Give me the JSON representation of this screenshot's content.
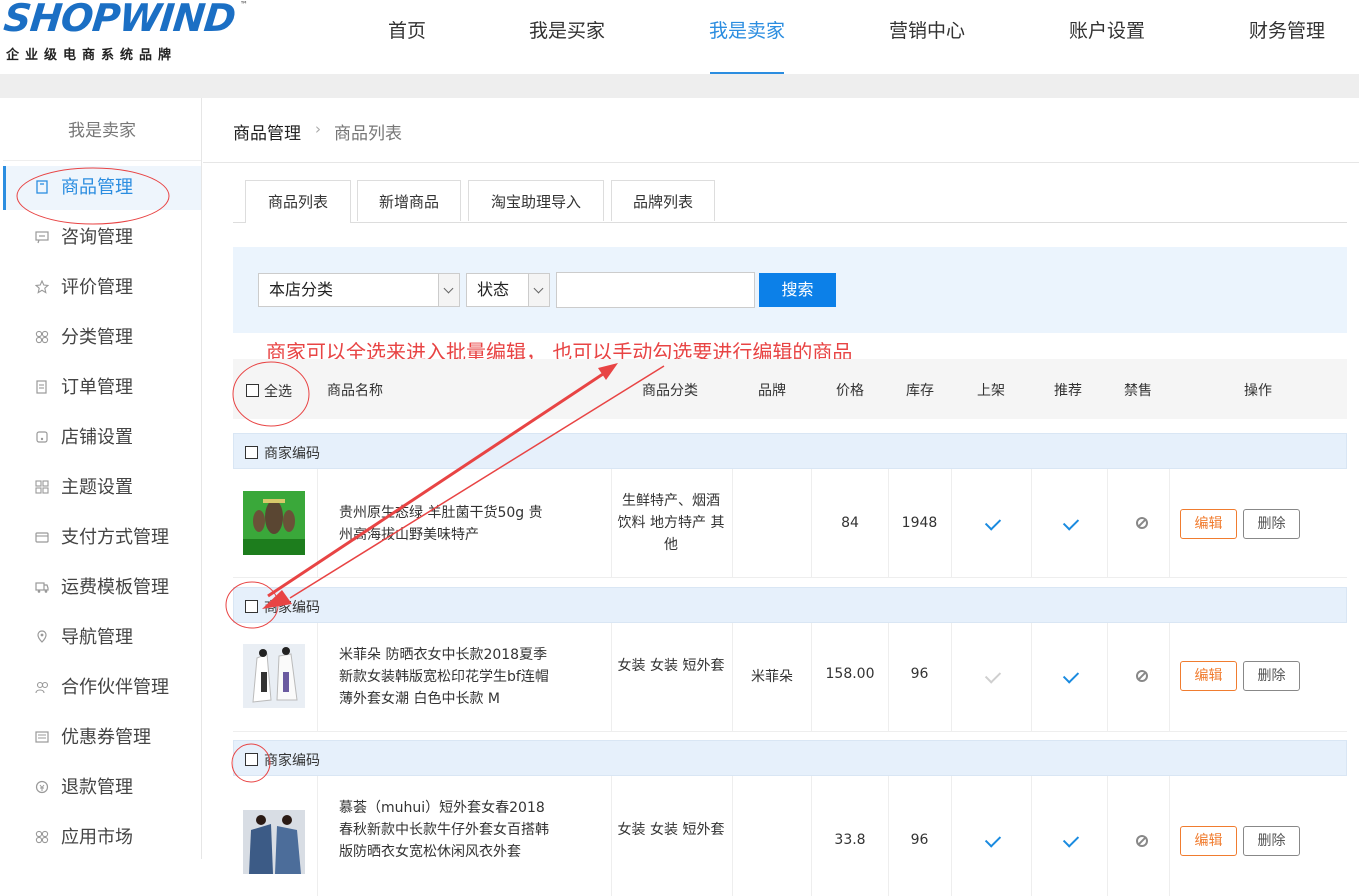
{
  "logo": {
    "main": "SHOPWIND",
    "tm": "™",
    "sub": "企业级电商系统品牌"
  },
  "nav": [
    "首页",
    "我是买家",
    "我是卖家",
    "营销中心",
    "账户设置",
    "财务管理"
  ],
  "nav_active": "我是卖家",
  "sidebar": {
    "title": "我是卖家",
    "items": [
      {
        "label": "商品管理",
        "icon": "goods-icon"
      },
      {
        "label": "咨询管理",
        "icon": "chat-icon"
      },
      {
        "label": "评价管理",
        "icon": "star-icon"
      },
      {
        "label": "分类管理",
        "icon": "category-icon"
      },
      {
        "label": "订单管理",
        "icon": "order-icon"
      },
      {
        "label": "店铺设置",
        "icon": "store-icon"
      },
      {
        "label": "主题设置",
        "icon": "theme-icon"
      },
      {
        "label": "支付方式管理",
        "icon": "wallet-icon"
      },
      {
        "label": "运费模板管理",
        "icon": "truck-icon"
      },
      {
        "label": "导航管理",
        "icon": "location-icon"
      },
      {
        "label": "合作伙伴管理",
        "icon": "partner-icon"
      },
      {
        "label": "优惠券管理",
        "icon": "coupon-icon"
      },
      {
        "label": "退款管理",
        "icon": "refund-icon"
      },
      {
        "label": "应用市场",
        "icon": "apps-icon"
      }
    ]
  },
  "breadcrumb": {
    "level1": "商品管理",
    "separator": "›",
    "level2": "商品列表"
  },
  "tabs": [
    "商品列表",
    "新增商品",
    "淘宝助理导入",
    "品牌列表"
  ],
  "search": {
    "category": "本店分类",
    "status": "状态",
    "keyword": "",
    "button": "搜索"
  },
  "annotation": "商家可以全选来进入批量编辑， 也可以手动勾选要进行编辑的商品",
  "table": {
    "select_all": "全选",
    "headers": {
      "name": "商品名称",
      "category": "商品分类",
      "brand": "品牌",
      "price": "价格",
      "stock": "库存",
      "on_shelf": "上架",
      "recommend": "推荐",
      "banned": "禁售",
      "actions": "操作"
    },
    "group_label": "商家编码",
    "rows": [
      {
        "name": "贵州原生态绿 羊肚菌干货50g 贵州高海拔山野美味特产",
        "category": "生鲜特产、烟酒饮料 地方特产 其他",
        "brand": "",
        "price": "84",
        "stock": "1948",
        "on_shelf": true,
        "recommend": true,
        "banned": false
      },
      {
        "name": "米菲朵 防晒衣女中长款2018夏季新款女装韩版宽松印花学生bf连帽薄外套女潮 白色中长款 M",
        "category": "女装 女装 短外套",
        "brand": "米菲朵",
        "price": "158.00",
        "stock": "96",
        "on_shelf": false,
        "recommend": true,
        "banned": false
      },
      {
        "name": "慕荟（muhui）短外套女春2018春秋新款中长款牛仔外套女百搭韩版防晒衣女宽松休闲风衣外套",
        "category": "女装 女装 短外套",
        "brand": "",
        "price": "33.8",
        "stock": "96",
        "on_shelf": true,
        "recommend": true,
        "banned": false
      }
    ],
    "edit_label": "编辑",
    "delete_label": "删除"
  },
  "colors": {
    "accent": "#2b8de0",
    "search_button": "#0c80e8",
    "edit": "#f07c2f",
    "annotation": "#e84444",
    "logo": "#1b6fc4"
  }
}
